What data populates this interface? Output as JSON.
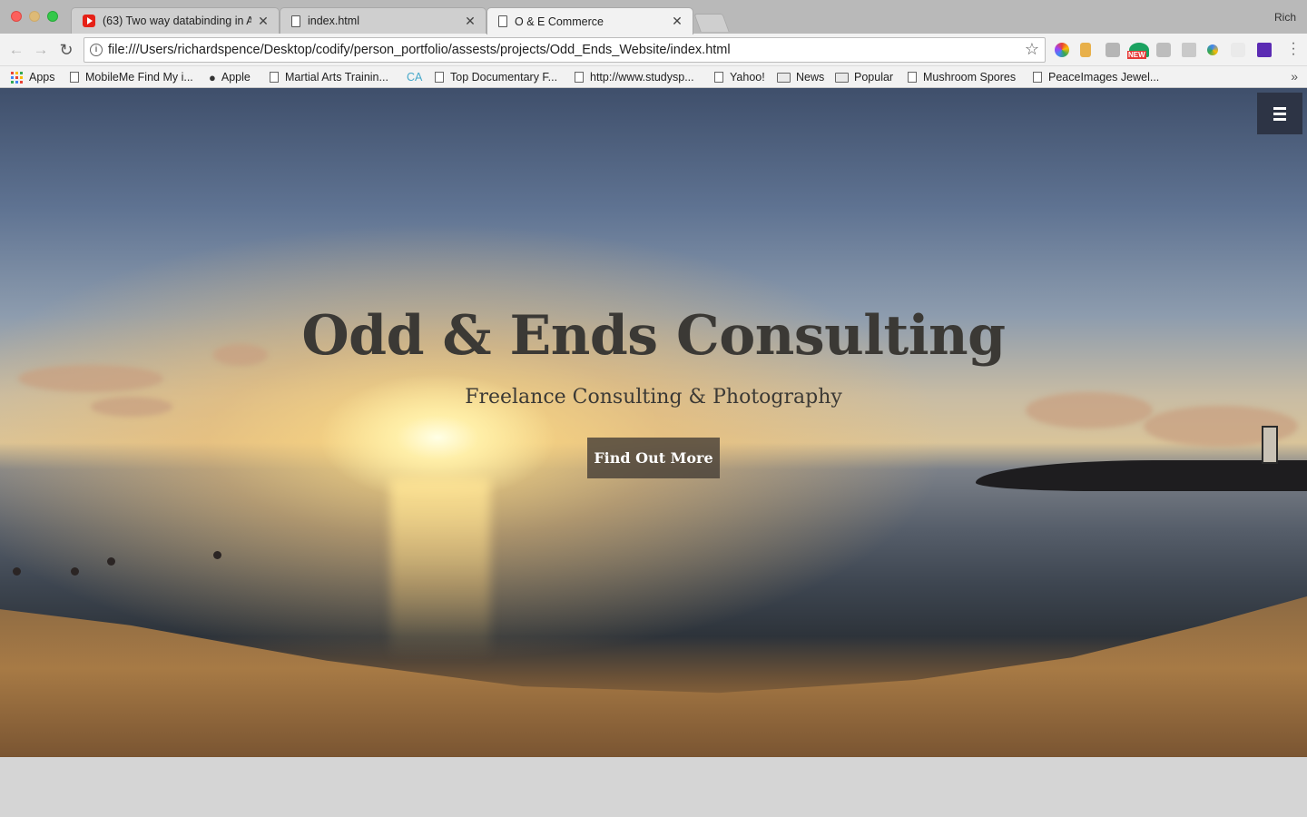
{
  "browser": {
    "tabs": [
      {
        "title": "(63) Two way databinding in A",
        "icon": "youtube-icon",
        "active": false
      },
      {
        "title": "index.html",
        "icon": "document-icon",
        "active": false
      },
      {
        "title": "O & E Commerce",
        "icon": "document-icon",
        "active": true
      }
    ],
    "profile_name": "Rich",
    "address": "file:///Users/richardspence/Desktop/codify/person_portfolio/assests/projects/Odd_Ends_Website/index.html",
    "bookmarks": [
      {
        "label": "Apps",
        "icon": "apps-grid-icon"
      },
      {
        "label": "MobileMe Find My i...",
        "icon": "page-icon"
      },
      {
        "label": "Apple",
        "icon": "apple-icon"
      },
      {
        "label": "Martial Arts Trainin...",
        "icon": "page-icon"
      },
      {
        "label": "CA",
        "icon": "ca-icon"
      },
      {
        "label": "Top Documentary F...",
        "icon": "page-icon"
      },
      {
        "label": "http://www.studysp...",
        "icon": "page-icon"
      },
      {
        "label": "Yahoo!",
        "icon": "page-icon"
      },
      {
        "label": "News",
        "icon": "folder-icon"
      },
      {
        "label": "Popular",
        "icon": "folder-icon"
      },
      {
        "label": "Mushroom Spores",
        "icon": "page-icon"
      },
      {
        "label": "PeaceImages Jewel...",
        "icon": "page-icon"
      }
    ],
    "extension_badge": "NEW"
  },
  "page": {
    "hero_title": "Odd & Ends Consulting",
    "hero_subtitle": "Freelance Consulting & Photography",
    "cta_label": "Find Out More",
    "menu_icon": "hamburger-menu-icon"
  }
}
